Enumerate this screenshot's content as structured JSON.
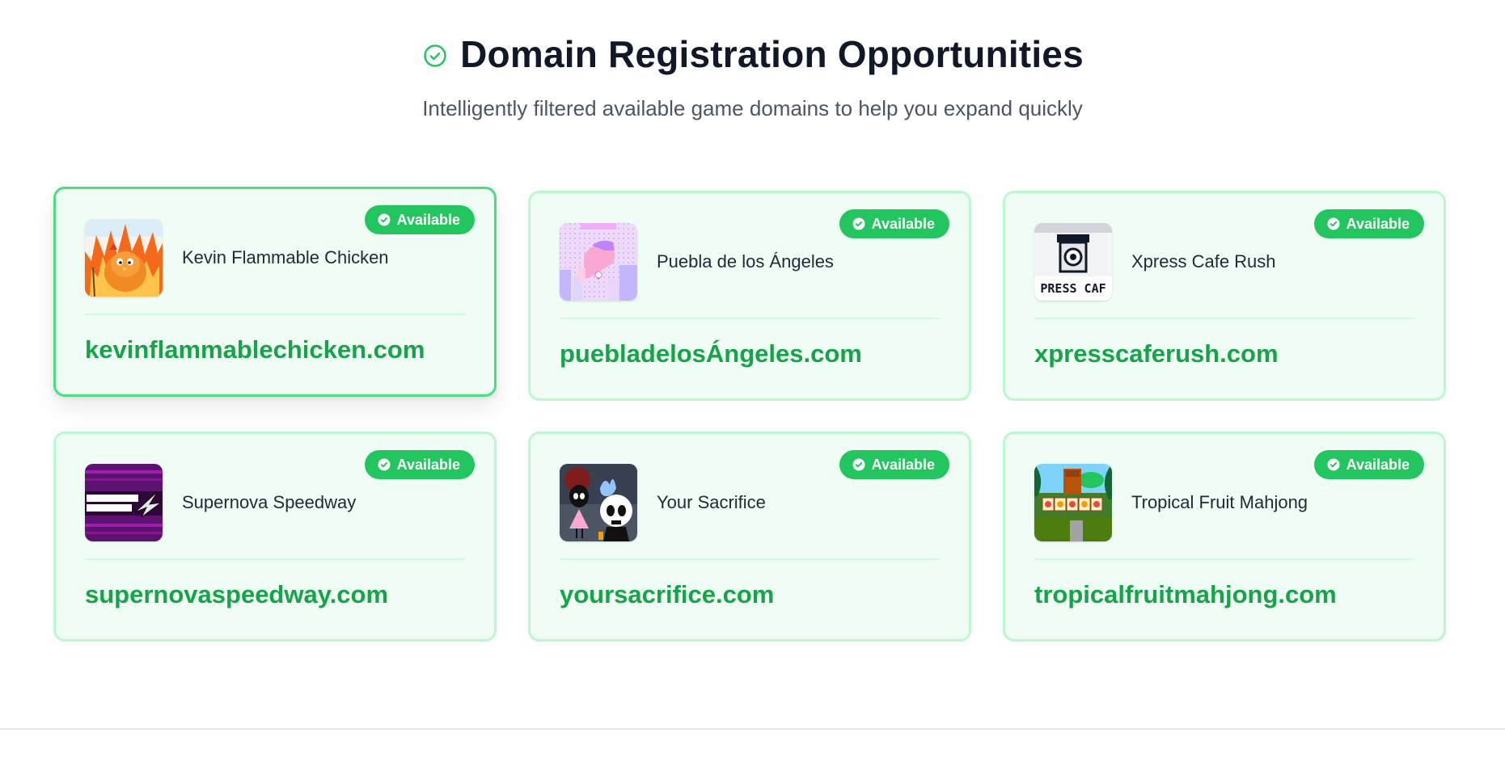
{
  "header": {
    "title": "Domain Registration Opportunities",
    "subtitle": "Intelligently filtered available game domains to help you expand quickly",
    "icon": "check-circle-icon"
  },
  "colors": {
    "accent": "#22c55e",
    "domain_text": "#16a34a",
    "card_background": "#f0fdf4",
    "card_border": "#bbf7d0",
    "card_border_hover": "#4ade80"
  },
  "cards": [
    {
      "game_name": "Kevin Flammable Chicken",
      "domain": "kevinflammablechicken.com",
      "badge": "Available",
      "thumbnail": "flaming-chicken-thumbnail",
      "hovered": true
    },
    {
      "game_name": "Puebla de los Ángeles",
      "domain": "puebladelosÁngeles.com",
      "badge": "Available",
      "thumbnail": "pink-pixel-city-thumbnail",
      "hovered": false
    },
    {
      "game_name": "Xpress Cafe Rush",
      "domain": "xpresscaferush.com",
      "badge": "Available",
      "thumbnail": "coffee-cup-pixel-thumbnail",
      "thumb_text": "PRESS CAF",
      "hovered": false
    },
    {
      "game_name": "Supernova Speedway",
      "domain": "supernovaspeedway.com",
      "badge": "Available",
      "thumbnail": "supernova-logo-thumbnail",
      "hovered": false
    },
    {
      "game_name": "Your Sacrifice",
      "domain": "yoursacrifice.com",
      "badge": "Available",
      "thumbnail": "skull-characters-thumbnail",
      "hovered": false
    },
    {
      "game_name": "Tropical Fruit Mahjong",
      "domain": "tropicalfruitmahjong.com",
      "badge": "Available",
      "thumbnail": "jungle-mahjong-thumbnail",
      "hovered": false
    }
  ]
}
